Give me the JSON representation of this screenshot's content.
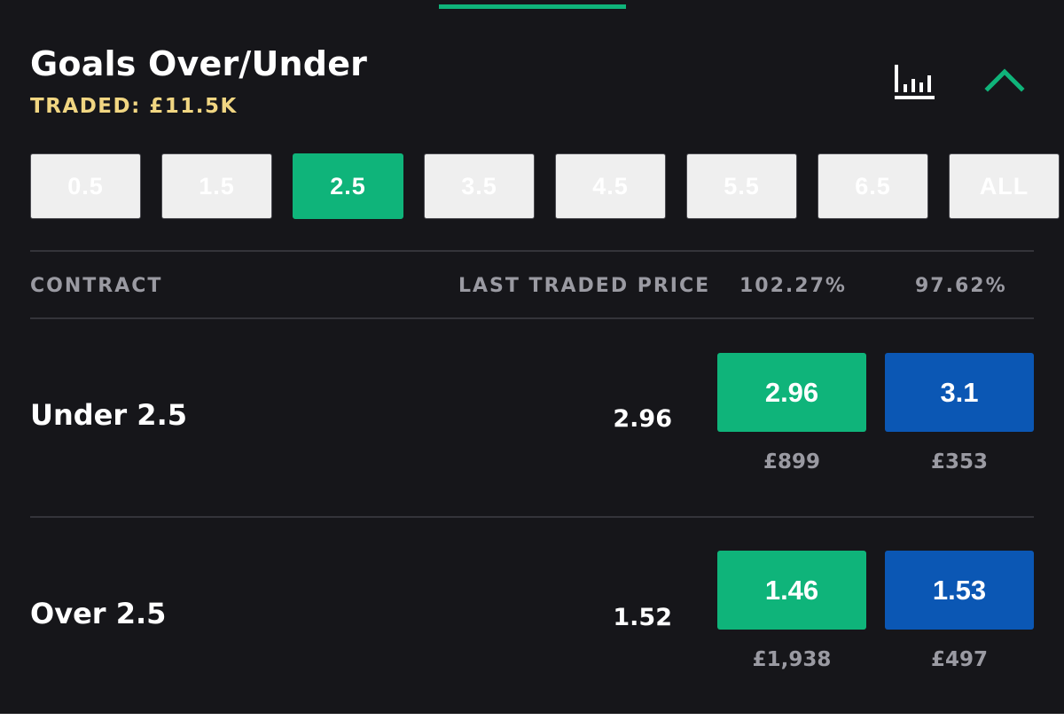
{
  "market": {
    "title": "Goals Over/Under",
    "traded_label": "TRADED: £11.5K"
  },
  "icons": {
    "chart": "bar-chart-icon",
    "collapse": "chevron-up-icon"
  },
  "colors": {
    "background": "#16161a",
    "accent": "#0fb47a",
    "lay": "#0b57b4",
    "traded": "#f1d682",
    "muted": "#9a9aa2"
  },
  "lines": [
    {
      "label": "0.5",
      "active": false
    },
    {
      "label": "1.5",
      "active": false
    },
    {
      "label": "2.5",
      "active": true
    },
    {
      "label": "3.5",
      "active": false
    },
    {
      "label": "4.5",
      "active": false
    },
    {
      "label": "5.5",
      "active": false
    },
    {
      "label": "6.5",
      "active": false
    },
    {
      "label": "ALL",
      "active": false
    }
  ],
  "columns": {
    "contract": "CONTRACT",
    "last_traded_price": "LAST TRADED PRICE",
    "back_book": "102.27%",
    "lay_book": "97.62%"
  },
  "contracts": [
    {
      "name": "Under 2.5",
      "ltp": "2.96",
      "back_price": "2.96",
      "lay_price": "3.1",
      "back_volume": "£899",
      "lay_volume": "£353"
    },
    {
      "name": "Over 2.5",
      "ltp": "1.52",
      "back_price": "1.46",
      "lay_price": "1.53",
      "back_volume": "£1,938",
      "lay_volume": "£497"
    }
  ]
}
